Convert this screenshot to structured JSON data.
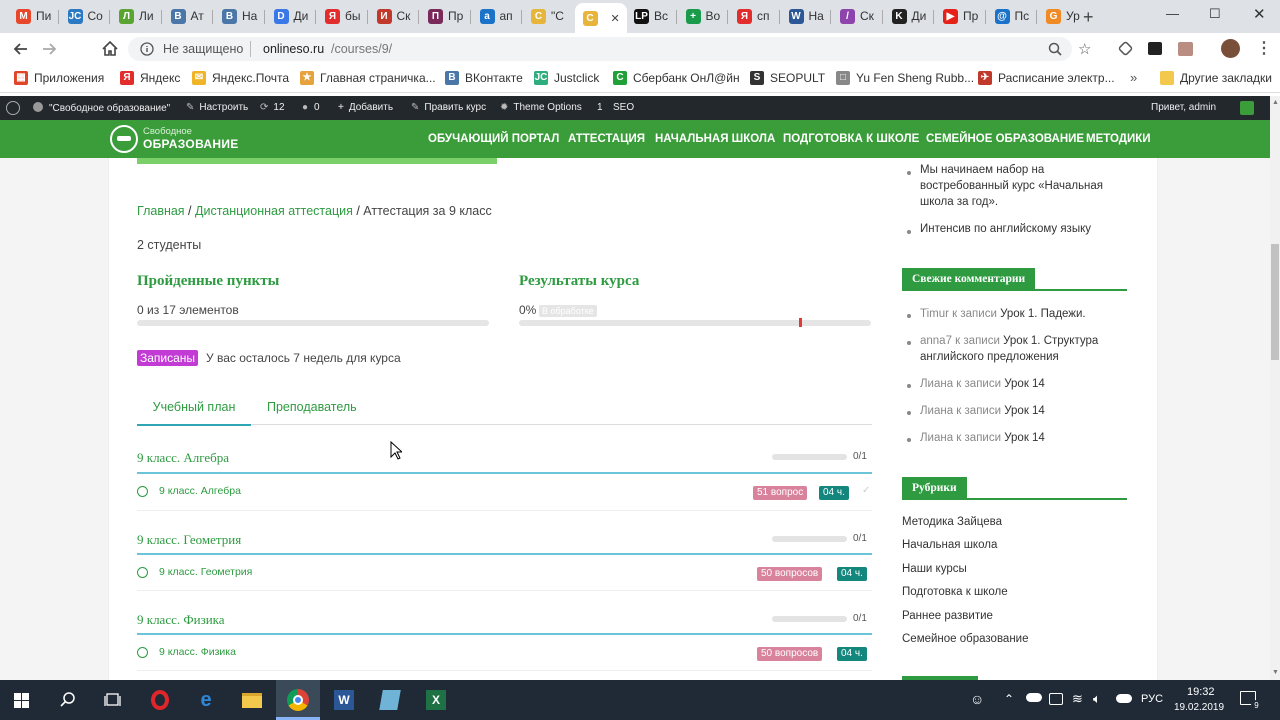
{
  "browser": {
    "tabs": [
      {
        "label": "Пи",
        "color": "#e8472c",
        "glyph": "M"
      },
      {
        "label": "Co",
        "color": "#2b79c2",
        "glyph": "JC"
      },
      {
        "label": "Ли",
        "color": "#5aa531",
        "glyph": "Л"
      },
      {
        "label": "Ат",
        "color": "#4a76a8",
        "glyph": "В"
      },
      {
        "label": "На",
        "color": "#4a76a8",
        "glyph": "В"
      },
      {
        "label": "Ди",
        "color": "#3b78e7",
        "glyph": "D"
      },
      {
        "label": "бы",
        "color": "#e32d2d",
        "glyph": "Я"
      },
      {
        "label": "Ск",
        "color": "#c0392b",
        "glyph": "И"
      },
      {
        "label": "Пр",
        "color": "#7a2a5a",
        "glyph": "П"
      },
      {
        "label": "ап",
        "color": "#1a73c9",
        "glyph": "a"
      },
      {
        "label": "\"С",
        "color": "#e6b53a",
        "glyph": "С"
      },
      {
        "label": "",
        "color": "#e6b53a",
        "glyph": "С"
      },
      {
        "label": "Вс",
        "color": "#111111",
        "glyph": "LP"
      },
      {
        "label": "Во",
        "color": "#1a9b4b",
        "glyph": "+"
      },
      {
        "label": "сп",
        "color": "#e32d2d",
        "glyph": "Я"
      },
      {
        "label": "На",
        "color": "#2b5797",
        "glyph": "W"
      },
      {
        "label": "Ск",
        "color": "#8e44ad",
        "glyph": "/"
      },
      {
        "label": "Ди",
        "color": "#222222",
        "glyph": "K"
      },
      {
        "label": "Пр",
        "color": "#e62117",
        "glyph": "▶"
      },
      {
        "label": "Пс",
        "color": "#1a73c9",
        "glyph": "@"
      },
      {
        "label": "Ур",
        "color": "#f08a24",
        "glyph": "G"
      }
    ],
    "active_tab_close": "✕",
    "new_tab": "+",
    "win_min": "—",
    "win_max": "☐",
    "win_close": "✕",
    "security_label": "Не защищено",
    "url_domain": "onlineso.ru",
    "url_path": "/courses/9/",
    "bookmarks": [
      {
        "label": "Приложения",
        "color": "#e0452a",
        "glyph": "▦"
      },
      {
        "label": "Яндекс",
        "color": "#e32d2d",
        "glyph": "Я"
      },
      {
        "label": "Яндекс.Почта",
        "color": "#f0b429",
        "glyph": "✉"
      },
      {
        "label": "Главная страничка...",
        "color": "#e6a23c",
        "glyph": "★"
      },
      {
        "label": "ВКонтакте",
        "color": "#4a76a8",
        "glyph": "В"
      },
      {
        "label": "Justclick",
        "color": "#2eae7f",
        "glyph": "JC"
      },
      {
        "label": "Сбербанк ОнЛ@йн",
        "color": "#21a038",
        "glyph": "С"
      },
      {
        "label": "SEOPULT",
        "color": "#333333",
        "glyph": "S"
      },
      {
        "label": "Yu Fen Sheng Rubb...",
        "color": "#888888",
        "glyph": "□"
      },
      {
        "label": "Расписание электр...",
        "color": "#c0392b",
        "glyph": "✈"
      }
    ],
    "bookmarks_more": "»",
    "other_bookmarks": "Другие закладки"
  },
  "wpbar": {
    "site": "\"Свободное образование\"",
    "customize": "Настроить",
    "updates": "12",
    "comments": "0",
    "add": "Добавить",
    "edit": "Править курс",
    "theme": "Theme Options",
    "theme_count": "1",
    "seo": "SEO",
    "greeting": "Привет, admin"
  },
  "site": {
    "logo_top": "Свободное",
    "logo_bottom": "ОБРАЗОВАНИЕ",
    "nav": [
      "ОБУЧАЮЩИЙ ПОРТАЛ",
      "АТТЕСТАЦИЯ",
      "НАЧАЛЬНАЯ ШКОЛА",
      "ПОДГОТОВКА К ШКОЛЕ",
      "СЕМЕЙНОЕ ОБРАЗОВАНИЕ",
      "МЕТОДИКИ"
    ]
  },
  "course": {
    "crumb_home": "Главная",
    "crumb_sep1": " / ",
    "crumb_cat": "Дистанционная аттестация",
    "crumb_sep2": " / ",
    "crumb_current": "Аттестация за 9 класс",
    "students": "2 студенты",
    "passed_title": "Пройденные пункты",
    "passed_text": "0 из 17 элементов",
    "passed_fraction": 0,
    "results_title": "Результаты курса",
    "results_percent": "0%",
    "results_badge": "В обработке",
    "enrolled_badge": "Записаны",
    "remaining": "У вас осталось 7 недель для курса",
    "tab_plan": "Учебный план",
    "tab_teacher": "Преподаватель",
    "sections": [
      {
        "title": "9 класс. Алгебра",
        "count": "0/1",
        "lesson": "9 класс. Алгебра",
        "questions": "51 вопрос",
        "hours": "04 ч."
      },
      {
        "title": "9 класс. Геометрия",
        "count": "0/1",
        "lesson": "9 класс. Геометрия",
        "questions": "50 вопросов",
        "hours": "04 ч."
      },
      {
        "title": "9 класс. Физика",
        "count": "0/1",
        "lesson": "9 класс. Физика",
        "questions": "50 вопросов",
        "hours": "04 ч."
      }
    ]
  },
  "sidebar": {
    "news": [
      "Мы начинаем набор на востребованный курс «Начальная школа за год».",
      "Интенсив по английскому языку"
    ],
    "comments_title": "Свежие комментарии",
    "comments": [
      {
        "author": "Timur к записи",
        "post": "Урок 1. Падежи."
      },
      {
        "author": "anna7 к записи",
        "post": "Урок 1. Структура английского предложения"
      },
      {
        "author": "Лиана к записи",
        "post": "Урок 14"
      },
      {
        "author": "Лиана к записи",
        "post": "Урок 14"
      },
      {
        "author": "Лиана к записи",
        "post": "Урок 14"
      }
    ],
    "categories_title": "Рубрики",
    "categories": [
      "Методика Зайцева",
      "Начальная школа",
      "Наши курсы",
      "Подготовка к школе",
      "Раннее развитие",
      "Семейное образование"
    ]
  },
  "taskbar": {
    "lang": "РУС",
    "time": "19:32",
    "date": "19.02.2019",
    "notif": "9"
  }
}
